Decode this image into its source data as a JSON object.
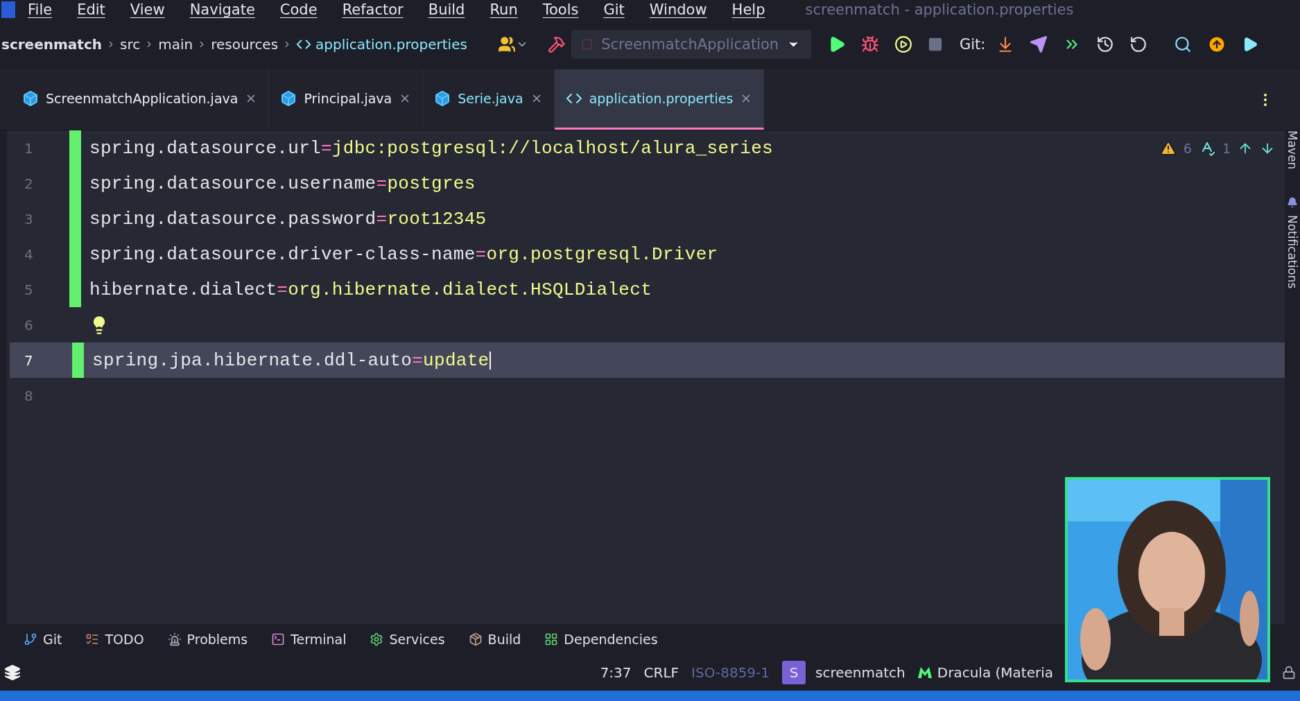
{
  "menu": [
    "File",
    "Edit",
    "View",
    "Navigate",
    "Code",
    "Refactor",
    "Build",
    "Run",
    "Tools",
    "Git",
    "Window",
    "Help"
  ],
  "window": {
    "title": "screenmatch - application.properties"
  },
  "breadcrumbs": [
    "screenmatch",
    "src",
    "main",
    "resources",
    "application.properties"
  ],
  "run_config": {
    "label": "ScreenmatchApplication"
  },
  "git_label": "Git:",
  "tabs": [
    {
      "label": "ScreenmatchApplication.java",
      "kind": "java",
      "modified": false,
      "selected": false
    },
    {
      "label": "Principal.java",
      "kind": "java",
      "modified": false,
      "selected": false
    },
    {
      "label": "Serie.java",
      "kind": "java",
      "modified": true,
      "selected": false
    },
    {
      "label": "application.properties",
      "kind": "properties",
      "modified": true,
      "selected": true
    }
  ],
  "inspections": {
    "warnings": "6",
    "typos": "1"
  },
  "lines": [
    {
      "number": "1",
      "changed": true,
      "current": false,
      "key": "spring.datasource.url",
      "sep": "=",
      "value": "jdbc:postgresql://localhost/alura_series"
    },
    {
      "number": "2",
      "changed": true,
      "current": false,
      "key": "spring.datasource.username",
      "sep": "=",
      "value": "postgres"
    },
    {
      "number": "3",
      "changed": true,
      "current": false,
      "key": "spring.datasource.password",
      "sep": "=",
      "value": "root12345"
    },
    {
      "number": "4",
      "changed": true,
      "current": false,
      "key": "spring.datasource.driver-class-name",
      "sep": "=",
      "value": "org.postgresql.Driver"
    },
    {
      "number": "5",
      "changed": true,
      "current": false,
      "key": "hibernate.dialect",
      "sep": "=",
      "value": "org.hibernate.dialect.HSQLDialect"
    },
    {
      "number": "6",
      "changed": false,
      "current": false,
      "bulb": true
    },
    {
      "number": "7",
      "changed": true,
      "current": true,
      "key": "spring.jpa.hibernate.ddl-auto",
      "sep": "=",
      "value": "update"
    },
    {
      "number": "8",
      "changed": false,
      "current": false
    }
  ],
  "right_strip": [
    "Maven",
    "Notifications"
  ],
  "tool_windows": [
    {
      "label": "Git",
      "kind": "git"
    },
    {
      "label": "TODO",
      "kind": "todo"
    },
    {
      "label": "Problems",
      "kind": "problems"
    },
    {
      "label": "Terminal",
      "kind": "terminal"
    },
    {
      "label": "Services",
      "kind": "services"
    },
    {
      "label": "Build",
      "kind": "build"
    },
    {
      "label": "Dependencies",
      "kind": "dependencies"
    }
  ],
  "status_bar": {
    "position": "7:37",
    "line_separator": "CRLF",
    "encoding": "ISO-8859-1",
    "project_badge": "S",
    "project": "screenmatch",
    "theme": "Dracula (Materia"
  }
}
